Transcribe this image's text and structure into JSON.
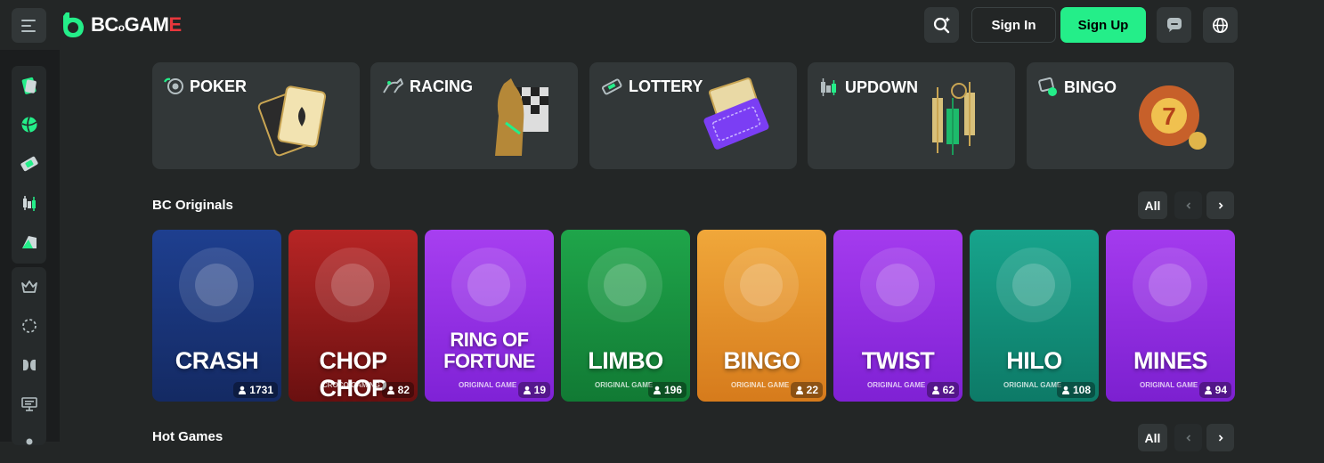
{
  "brand": {
    "name_prefix": "BC",
    "name_main": "GAM",
    "name_e": "E",
    "accent": "#24ee89"
  },
  "header": {
    "signin_label": "Sign In",
    "signup_label": "Sign Up"
  },
  "sidebar": {
    "items": [
      "casino-icon",
      "sports-icon",
      "lottery-icon",
      "updown-icon",
      "promo-icon",
      "vip-icon",
      "spin-icon",
      "affiliate-icon",
      "stream-icon",
      "more-icon"
    ]
  },
  "categories": [
    {
      "label": "POKER",
      "icon": "poker-chip-icon"
    },
    {
      "label": "RACING",
      "icon": "horse-icon"
    },
    {
      "label": "LOTTERY",
      "icon": "ticket-icon"
    },
    {
      "label": "UPDOWN",
      "icon": "candlestick-icon"
    },
    {
      "label": "BINGO",
      "icon": "bingo-icon"
    }
  ],
  "originals": {
    "title": "BC Originals",
    "all_label": "All",
    "games": [
      {
        "title": "CRASH",
        "sub": "",
        "players": "1731",
        "bg1": "#1e3f8f",
        "bg2": "#142a63"
      },
      {
        "title": "CHOP CHOP",
        "sub": "CROCO GAMING",
        "players": "82",
        "bg1": "#b72525",
        "bg2": "#6a1010"
      },
      {
        "title": "RING OF FORTUNE",
        "sub": "ORIGINAL GAME",
        "players": "19",
        "bg1": "#a73ff0",
        "bg2": "#7f22d6"
      },
      {
        "title": "LIMBO",
        "sub": "ORIGINAL GAME",
        "players": "196",
        "bg1": "#1fa54a",
        "bg2": "#117a34"
      },
      {
        "title": "BINGO",
        "sub": "ORIGINAL GAME",
        "players": "22",
        "bg1": "#f0a73a",
        "bg2": "#d67b1c"
      },
      {
        "title": "TWIST",
        "sub": "ORIGINAL GAME",
        "players": "62",
        "bg1": "#a43bee",
        "bg2": "#7f21d4"
      },
      {
        "title": "HILO",
        "sub": "ORIGINAL GAME",
        "players": "108",
        "bg1": "#17a48c",
        "bg2": "#0d7a67"
      },
      {
        "title": "MINES",
        "sub": "ORIGINAL GAME",
        "players": "94",
        "bg1": "#a43bee",
        "bg2": "#7c20d0"
      }
    ]
  },
  "hot": {
    "title": "Hot Games",
    "all_label": "All"
  }
}
